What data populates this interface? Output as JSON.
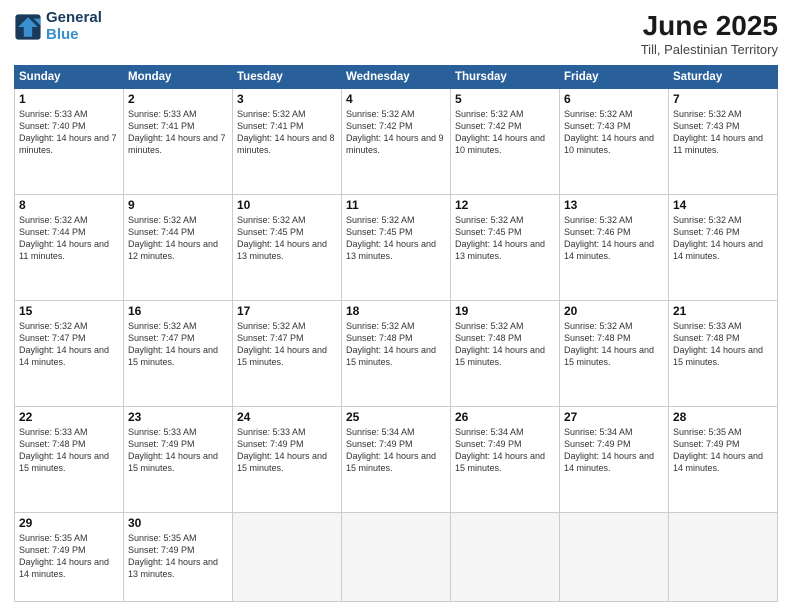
{
  "logo": {
    "line1": "General",
    "line2": "Blue"
  },
  "title": "June 2025",
  "location": "Till, Palestinian Territory",
  "headers": [
    "Sunday",
    "Monday",
    "Tuesday",
    "Wednesday",
    "Thursday",
    "Friday",
    "Saturday"
  ],
  "weeks": [
    [
      {
        "day": "1",
        "sunrise": "Sunrise: 5:33 AM",
        "sunset": "Sunset: 7:40 PM",
        "daylight": "Daylight: 14 hours and 7 minutes."
      },
      {
        "day": "2",
        "sunrise": "Sunrise: 5:33 AM",
        "sunset": "Sunset: 7:41 PM",
        "daylight": "Daylight: 14 hours and 7 minutes."
      },
      {
        "day": "3",
        "sunrise": "Sunrise: 5:32 AM",
        "sunset": "Sunset: 7:41 PM",
        "daylight": "Daylight: 14 hours and 8 minutes."
      },
      {
        "day": "4",
        "sunrise": "Sunrise: 5:32 AM",
        "sunset": "Sunset: 7:42 PM",
        "daylight": "Daylight: 14 hours and 9 minutes."
      },
      {
        "day": "5",
        "sunrise": "Sunrise: 5:32 AM",
        "sunset": "Sunset: 7:42 PM",
        "daylight": "Daylight: 14 hours and 10 minutes."
      },
      {
        "day": "6",
        "sunrise": "Sunrise: 5:32 AM",
        "sunset": "Sunset: 7:43 PM",
        "daylight": "Daylight: 14 hours and 10 minutes."
      },
      {
        "day": "7",
        "sunrise": "Sunrise: 5:32 AM",
        "sunset": "Sunset: 7:43 PM",
        "daylight": "Daylight: 14 hours and 11 minutes."
      }
    ],
    [
      {
        "day": "8",
        "sunrise": "Sunrise: 5:32 AM",
        "sunset": "Sunset: 7:44 PM",
        "daylight": "Daylight: 14 hours and 11 minutes."
      },
      {
        "day": "9",
        "sunrise": "Sunrise: 5:32 AM",
        "sunset": "Sunset: 7:44 PM",
        "daylight": "Daylight: 14 hours and 12 minutes."
      },
      {
        "day": "10",
        "sunrise": "Sunrise: 5:32 AM",
        "sunset": "Sunset: 7:45 PM",
        "daylight": "Daylight: 14 hours and 13 minutes."
      },
      {
        "day": "11",
        "sunrise": "Sunrise: 5:32 AM",
        "sunset": "Sunset: 7:45 PM",
        "daylight": "Daylight: 14 hours and 13 minutes."
      },
      {
        "day": "12",
        "sunrise": "Sunrise: 5:32 AM",
        "sunset": "Sunset: 7:45 PM",
        "daylight": "Daylight: 14 hours and 13 minutes."
      },
      {
        "day": "13",
        "sunrise": "Sunrise: 5:32 AM",
        "sunset": "Sunset: 7:46 PM",
        "daylight": "Daylight: 14 hours and 14 minutes."
      },
      {
        "day": "14",
        "sunrise": "Sunrise: 5:32 AM",
        "sunset": "Sunset: 7:46 PM",
        "daylight": "Daylight: 14 hours and 14 minutes."
      }
    ],
    [
      {
        "day": "15",
        "sunrise": "Sunrise: 5:32 AM",
        "sunset": "Sunset: 7:47 PM",
        "daylight": "Daylight: 14 hours and 14 minutes."
      },
      {
        "day": "16",
        "sunrise": "Sunrise: 5:32 AM",
        "sunset": "Sunset: 7:47 PM",
        "daylight": "Daylight: 14 hours and 15 minutes."
      },
      {
        "day": "17",
        "sunrise": "Sunrise: 5:32 AM",
        "sunset": "Sunset: 7:47 PM",
        "daylight": "Daylight: 14 hours and 15 minutes."
      },
      {
        "day": "18",
        "sunrise": "Sunrise: 5:32 AM",
        "sunset": "Sunset: 7:48 PM",
        "daylight": "Daylight: 14 hours and 15 minutes."
      },
      {
        "day": "19",
        "sunrise": "Sunrise: 5:32 AM",
        "sunset": "Sunset: 7:48 PM",
        "daylight": "Daylight: 14 hours and 15 minutes."
      },
      {
        "day": "20",
        "sunrise": "Sunrise: 5:32 AM",
        "sunset": "Sunset: 7:48 PM",
        "daylight": "Daylight: 14 hours and 15 minutes."
      },
      {
        "day": "21",
        "sunrise": "Sunrise: 5:33 AM",
        "sunset": "Sunset: 7:48 PM",
        "daylight": "Daylight: 14 hours and 15 minutes."
      }
    ],
    [
      {
        "day": "22",
        "sunrise": "Sunrise: 5:33 AM",
        "sunset": "Sunset: 7:48 PM",
        "daylight": "Daylight: 14 hours and 15 minutes."
      },
      {
        "day": "23",
        "sunrise": "Sunrise: 5:33 AM",
        "sunset": "Sunset: 7:49 PM",
        "daylight": "Daylight: 14 hours and 15 minutes."
      },
      {
        "day": "24",
        "sunrise": "Sunrise: 5:33 AM",
        "sunset": "Sunset: 7:49 PM",
        "daylight": "Daylight: 14 hours and 15 minutes."
      },
      {
        "day": "25",
        "sunrise": "Sunrise: 5:34 AM",
        "sunset": "Sunset: 7:49 PM",
        "daylight": "Daylight: 14 hours and 15 minutes."
      },
      {
        "day": "26",
        "sunrise": "Sunrise: 5:34 AM",
        "sunset": "Sunset: 7:49 PM",
        "daylight": "Daylight: 14 hours and 15 minutes."
      },
      {
        "day": "27",
        "sunrise": "Sunrise: 5:34 AM",
        "sunset": "Sunset: 7:49 PM",
        "daylight": "Daylight: 14 hours and 14 minutes."
      },
      {
        "day": "28",
        "sunrise": "Sunrise: 5:35 AM",
        "sunset": "Sunset: 7:49 PM",
        "daylight": "Daylight: 14 hours and 14 minutes."
      }
    ],
    [
      {
        "day": "29",
        "sunrise": "Sunrise: 5:35 AM",
        "sunset": "Sunset: 7:49 PM",
        "daylight": "Daylight: 14 hours and 14 minutes."
      },
      {
        "day": "30",
        "sunrise": "Sunrise: 5:35 AM",
        "sunset": "Sunset: 7:49 PM",
        "daylight": "Daylight: 14 hours and 13 minutes."
      },
      null,
      null,
      null,
      null,
      null
    ]
  ]
}
